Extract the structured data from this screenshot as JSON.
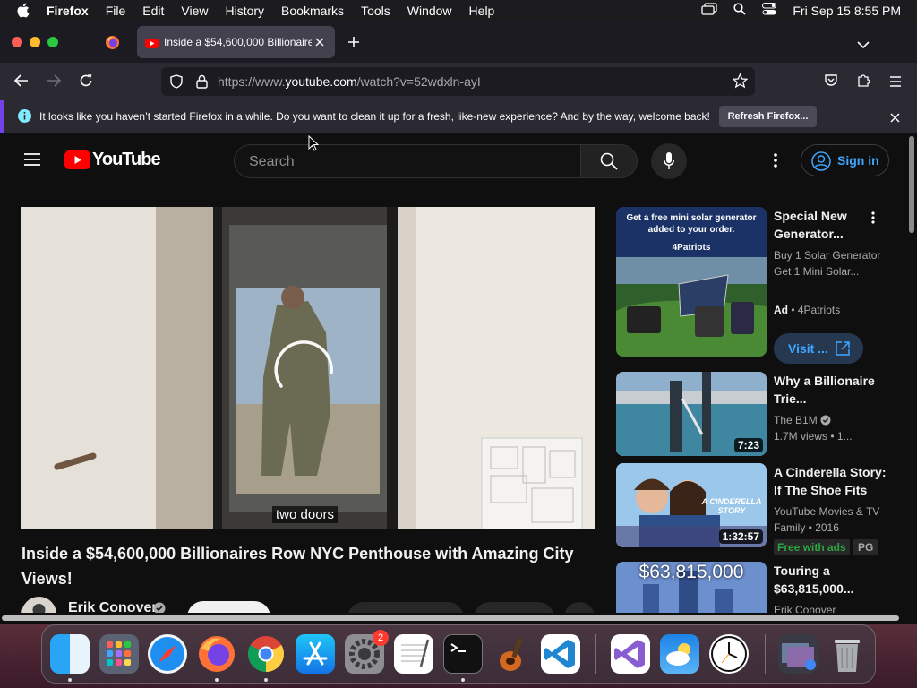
{
  "menubar": {
    "app": "Firefox",
    "items": [
      "File",
      "Edit",
      "View",
      "History",
      "Bookmarks",
      "Tools",
      "Window",
      "Help"
    ],
    "clock": "Fri Sep 15  8:55 PM"
  },
  "browser": {
    "tab_title": "Inside a $54,600,000 Billionaire",
    "url_prefix": "https://www.",
    "url_domain": "youtube.com",
    "url_path": "/watch?v=52wdxln-ayI",
    "notification": "It looks like you haven’t started Firefox in a while. Do you want to clean it up for a fresh, like-new experience? And by the way, welcome back!",
    "notification_button": "Refresh Firefox..."
  },
  "youtube": {
    "logo_text": "YouTube",
    "search_placeholder": "Search",
    "sign_in": "Sign in",
    "video": {
      "caption": "two doors",
      "title": "Inside a $54,600,000 Billionaires Row NYC Penthouse with Amazing City Views!",
      "channel": "Erik Conover"
    },
    "recommendations": [
      {
        "thumb_text": "Get a free mini solar generator added to your order.",
        "thumb_brand": "4Patriots",
        "title": "Special New Generator...",
        "desc": "Buy 1 Solar Generator Get 1 Mini Solar...",
        "ad_label": "Ad",
        "advertiser": "4Patriots",
        "visit_label": "Visit ..."
      },
      {
        "title": "Why a Billionaire Trie...",
        "channel": "The B1M",
        "meta": "1.7M views  • 1...",
        "duration": "7:23"
      },
      {
        "title": "A Cinderella Story: If The Shoe Fits",
        "channel": "YouTube Movies & TV",
        "meta": "Family • 2016",
        "badge_free": "Free with ads",
        "badge_rating": "PG",
        "duration": "1:32:57",
        "thumb_text": "A CINDERELLA STORY"
      },
      {
        "title": "Touring a $63,815,000...",
        "channel": "Erik Conover",
        "thumb_text": "$63,815,000"
      }
    ]
  },
  "dock": {
    "settings_badge": "2"
  }
}
